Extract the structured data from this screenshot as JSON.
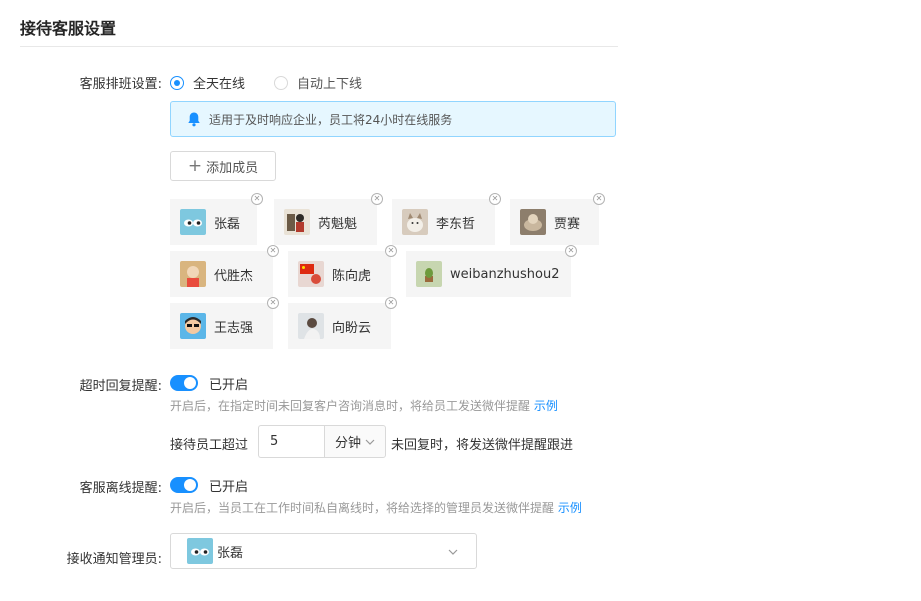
{
  "section_title": "接待客服设置",
  "schedule": {
    "label": "客服排班设置:",
    "options": [
      {
        "label": "全天在线",
        "selected": true
      },
      {
        "label": "自动上下线",
        "selected": false
      }
    ],
    "info_text": "适用于及时响应企业，员工将24小时在线服务",
    "info_icon": "bell-icon"
  },
  "add_member_label": "添加成员",
  "members": [
    {
      "name": "张磊",
      "avatar": "eyes"
    },
    {
      "name": "芮魁魁",
      "avatar": "figure"
    },
    {
      "name": "李东哲",
      "avatar": "cat"
    },
    {
      "name": "贾赛",
      "avatar": "dog"
    },
    {
      "name": "代胜杰",
      "avatar": "kid"
    },
    {
      "name": "陈向虎",
      "avatar": "flag"
    },
    {
      "name": "weibanzhushou2",
      "avatar": "cactus"
    },
    {
      "name": "王志强",
      "avatar": "cartoon"
    },
    {
      "name": "向盼云",
      "avatar": "portrait"
    }
  ],
  "timeout_reminder": {
    "label": "超时回复提醒:",
    "enabled": true,
    "status_text": "已开启",
    "hint": "开启后，在指定时间未回复客户咨询消息时，将给员工发送微伴提醒",
    "example_link": "示例",
    "prefix": "接待员工超过",
    "value": "5",
    "unit": "分钟",
    "suffix": "未回复时，将发送微伴提醒跟进"
  },
  "offline_reminder": {
    "label": "客服离线提醒:",
    "enabled": true,
    "status_text": "已开启",
    "hint": "开启后，当员工在工作时间私自离线时，将给选择的管理员发送微伴提醒",
    "example_link": "示例"
  },
  "notify_admin": {
    "label": "接收通知管理员:",
    "selected": "张磊"
  },
  "colors": {
    "accent": "#1890ff",
    "info_bg": "#e6f7ff",
    "info_border": "#91d5ff",
    "chip_bg": "#f5f5f5"
  }
}
